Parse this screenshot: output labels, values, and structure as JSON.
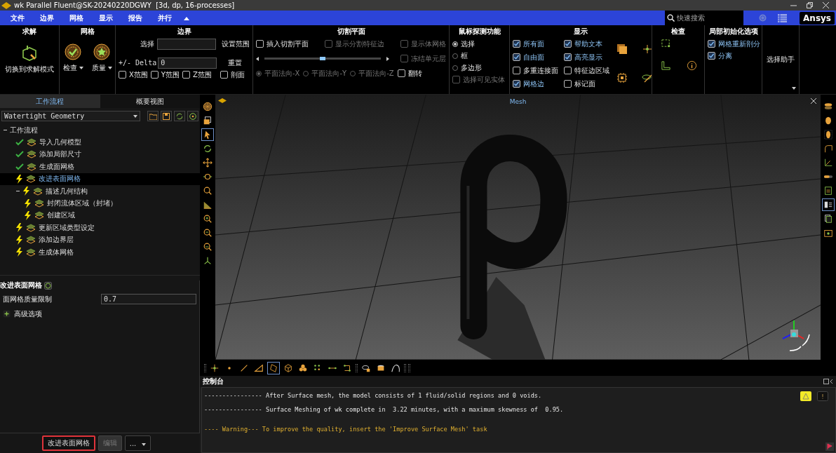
{
  "window": {
    "title": "wk Parallel Fluent@SK-20240220DGWY  [3d, dp, 16-processes]"
  },
  "menu": [
    "文件",
    "边界",
    "网格",
    "显示",
    "报告",
    "并行"
  ],
  "search": {
    "placeholder": "快速搜索"
  },
  "brand": "Ansys",
  "ribbon": {
    "solve": {
      "title": "求解",
      "button": "切换到求解模式"
    },
    "mesh": {
      "title": "网格",
      "buttons": [
        "检查",
        "质量"
      ]
    },
    "boundary": {
      "title": "边界",
      "select_label": "选择",
      "set_range": "设置范围",
      "delta_label": "+/- Delta",
      "delta_value": "0",
      "reset": "重置",
      "ranges": [
        {
          "label": "X范围",
          "checked": false
        },
        {
          "label": "Y范围",
          "checked": false
        },
        {
          "label": "Z范围",
          "checked": false
        }
      ],
      "section_view": {
        "label": "剖面",
        "checked": false
      }
    },
    "cut_plane": {
      "title": "切割平面",
      "options": [
        {
          "label": "插入切割平面",
          "checked": false,
          "disabled": false
        },
        {
          "label": "显示分割特征边",
          "checked": false,
          "disabled": true
        },
        {
          "label": "显示体网格",
          "checked": false,
          "disabled": true
        },
        {
          "label": "冻结单元层",
          "checked": false,
          "disabled": true
        }
      ],
      "slider": {
        "level": 0.5
      },
      "normals": [
        {
          "label": "平面法向-X",
          "selected": true,
          "disabled": true
        },
        {
          "label": "平面法向-Y",
          "selected": false,
          "disabled": true
        },
        {
          "label": "平面法向-Z",
          "selected": false,
          "disabled": true
        }
      ],
      "flip": {
        "label": "翻转",
        "checked": false
      }
    },
    "probe": {
      "title": "鼠标探测功能",
      "modes": [
        {
          "label": "选择",
          "selected": true
        },
        {
          "label": "框",
          "selected": false
        },
        {
          "label": "多边形",
          "selected": false
        }
      ],
      "visible_only": {
        "label": "选择可见实体",
        "checked": false,
        "disabled": true
      }
    },
    "display": {
      "title": "显示",
      "options": [
        {
          "label": "所有面",
          "checked": true
        },
        {
          "label": "帮助文本",
          "checked": true
        },
        {
          "label": "自由面",
          "checked": true
        },
        {
          "label": "高亮显示",
          "checked": true
        },
        {
          "label": "多重连接面",
          "checked": false
        },
        {
          "label": "特征边区域",
          "checked": false
        },
        {
          "label": "网格边",
          "checked": true
        },
        {
          "label": "标记面",
          "checked": false
        }
      ]
    },
    "check": {
      "title": "检查"
    },
    "local_init": {
      "title": "局部初始化选项",
      "options": [
        {
          "label": "网格重新剖分",
          "checked": true
        },
        {
          "label": "分离",
          "checked": true
        }
      ]
    },
    "selection_helper": "选择助手"
  },
  "panel_tabs": [
    {
      "label": "工作流程",
      "selected": true
    },
    {
      "label": "概要视图",
      "selected": false
    }
  ],
  "workflow": {
    "type": "Watertight Geometry",
    "tree": [
      {
        "label": "工作流程",
        "expanded": true,
        "children": [
          {
            "label": "导入几何模型",
            "done": true,
            "selected": false
          },
          {
            "label": "添加局部尺寸",
            "done": true,
            "selected": false
          },
          {
            "label": "生成面网格",
            "done": true,
            "selected": false
          },
          {
            "label": "改进表面网格",
            "done": false,
            "selected": true
          },
          {
            "label": "描述几何结构",
            "done": false,
            "selected": false,
            "expanded": true,
            "children": [
              {
                "label": "封闭流体区域（封堵）",
                "done": false,
                "selected": false
              },
              {
                "label": "创建区域",
                "done": false,
                "selected": false
              }
            ]
          },
          {
            "label": "更新区域类型设定",
            "done": false,
            "selected": false
          },
          {
            "label": "添加边界层",
            "done": false,
            "selected": false
          },
          {
            "label": "生成体网格",
            "done": false,
            "selected": false
          }
        ]
      }
    ]
  },
  "task": {
    "title": "改进表面网格",
    "fields": [
      {
        "label": "面网格质量限制",
        "value": "0.7"
      }
    ],
    "advanced": {
      "label": "高级选项",
      "expanded": false
    }
  },
  "actions": [
    {
      "label": "改进表面网格",
      "kind": "primary"
    },
    {
      "label": "编辑",
      "kind": "disabled"
    },
    {
      "label": "...",
      "kind": "menu"
    }
  ],
  "left_tools": [
    {
      "kind": "mesh-ball",
      "selected": false
    },
    {
      "kind": "cube",
      "selected": false
    },
    {
      "kind": "cursor",
      "selected": true
    },
    {
      "kind": "rotate",
      "selected": false
    },
    {
      "kind": "pan",
      "selected": false
    },
    {
      "kind": "zoom-arrow",
      "selected": false
    },
    {
      "kind": "magnifier",
      "selected": false
    },
    {
      "kind": "mountain",
      "selected": false
    },
    {
      "kind": "magnifier-plus",
      "selected": false
    },
    {
      "kind": "magnifier-minus",
      "selected": false
    },
    {
      "kind": "magnifier-dash",
      "selected": false
    },
    {
      "kind": "axes",
      "selected": false
    }
  ],
  "viewport": {
    "title": "Mesh"
  },
  "right_tools": [
    {
      "kind": "disc-stack",
      "selected": false
    },
    {
      "kind": "ellipse",
      "selected": false
    },
    {
      "kind": "ellipse-dotted",
      "selected": false
    },
    {
      "kind": "corner-curve",
      "selected": false
    },
    {
      "kind": "axes-plot",
      "selected": false
    },
    {
      "kind": "slider-bar",
      "selected": false
    },
    {
      "kind": "document",
      "selected": false
    },
    {
      "kind": "panel-list",
      "selected": true
    },
    {
      "kind": "copy",
      "selected": false
    },
    {
      "kind": "camera",
      "selected": false
    }
  ],
  "bottom_tools": [
    {
      "kind": "node-cross",
      "selected": false
    },
    {
      "kind": "dot",
      "selected": false
    },
    {
      "kind": "line",
      "selected": false
    },
    {
      "kind": "triangle",
      "selected": false
    },
    {
      "kind": "face-outline",
      "selected": true
    },
    {
      "kind": "cube-wire",
      "selected": false
    },
    {
      "kind": "spheres",
      "selected": false
    },
    {
      "kind": "dot-grid",
      "selected": false
    },
    {
      "kind": "edge-line",
      "selected": false
    },
    {
      "kind": "node-link",
      "selected": false
    },
    {
      "kind": "eye-box",
      "selected": false
    },
    {
      "kind": "cylinder",
      "selected": false
    },
    {
      "kind": "curve-a",
      "selected": false
    }
  ],
  "console": {
    "title": "控制台",
    "lines": [
      {
        "text": "---------------- After Surface mesh, the model consists of 1 fluid/solid regions and 0 voids.",
        "kind": "info"
      },
      {
        "text": "---------------- Surface Meshing of wk complete in  3.22 minutes, with a maximum skewness of  0.95.",
        "kind": "info"
      },
      {
        "text": "---- Warning--- To improve the quality, insert the 'Improve Surface Mesh' task",
        "kind": "warning"
      }
    ]
  }
}
